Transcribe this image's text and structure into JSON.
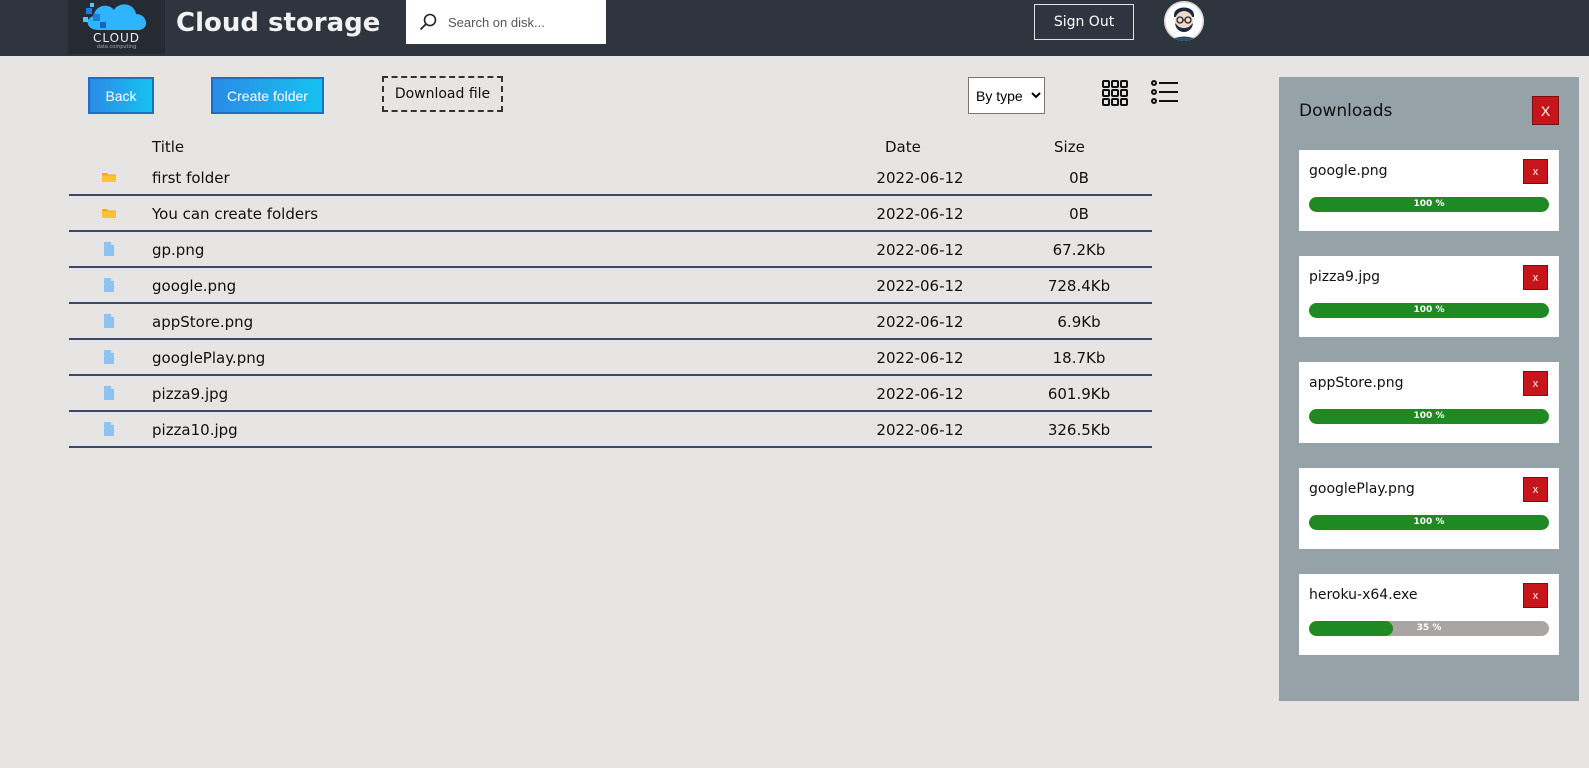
{
  "header": {
    "logo_text": "CLOUD",
    "logo_subtext": "data computing",
    "title": "Cloud storage",
    "search_placeholder": "Search on disk...",
    "search_icon": "search-icon",
    "signout_label": "Sign Out",
    "avatar_icon": "user-avatar"
  },
  "toolbar": {
    "back_label": "Back",
    "create_label": "Create folder",
    "download_label": "Download file",
    "sort_selected": "By type",
    "grid_icon": "grid-view-icon",
    "list_icon": "list-view-icon"
  },
  "table": {
    "headers": {
      "title": "Title",
      "date": "Date",
      "size": "Size"
    },
    "rows": [
      {
        "type": "folder",
        "name": "first folder",
        "date": "2022-06-12",
        "size": "0B"
      },
      {
        "type": "folder",
        "name": "You can create folders",
        "date": "2022-06-12",
        "size": "0B"
      },
      {
        "type": "file",
        "name": "gp.png",
        "date": "2022-06-12",
        "size": "67.2Kb"
      },
      {
        "type": "file",
        "name": "google.png",
        "date": "2022-06-12",
        "size": "728.4Kb"
      },
      {
        "type": "file",
        "name": "appStore.png",
        "date": "2022-06-12",
        "size": "6.9Kb"
      },
      {
        "type": "file",
        "name": "googlePlay.png",
        "date": "2022-06-12",
        "size": "18.7Kb"
      },
      {
        "type": "file",
        "name": "pizza9.jpg",
        "date": "2022-06-12",
        "size": "601.9Kb"
      },
      {
        "type": "file",
        "name": "pizza10.jpg",
        "date": "2022-06-12",
        "size": "326.5Kb"
      }
    ]
  },
  "downloads": {
    "title": "Downloads",
    "close_label": "X",
    "item_close_label": "x",
    "items": [
      {
        "name": "google.png",
        "progress": 100,
        "label": "100 %"
      },
      {
        "name": "pizza9.jpg",
        "progress": 100,
        "label": "100 %"
      },
      {
        "name": "appStore.png",
        "progress": 100,
        "label": "100 %"
      },
      {
        "name": "googlePlay.png",
        "progress": 100,
        "label": "100 %"
      },
      {
        "name": "heroku-x64.exe",
        "progress": 35,
        "label": "35 %"
      }
    ]
  },
  "colors": {
    "navbar": "#2e353f",
    "accent_blue": "#16c2f0",
    "row_divider": "#3b4a6b",
    "panel": "#95a3a8",
    "close_red": "#c7161b",
    "progress_green": "#1f8a24",
    "folder_orange": "#f7a81b",
    "file_blue": "#8cc3f0"
  }
}
